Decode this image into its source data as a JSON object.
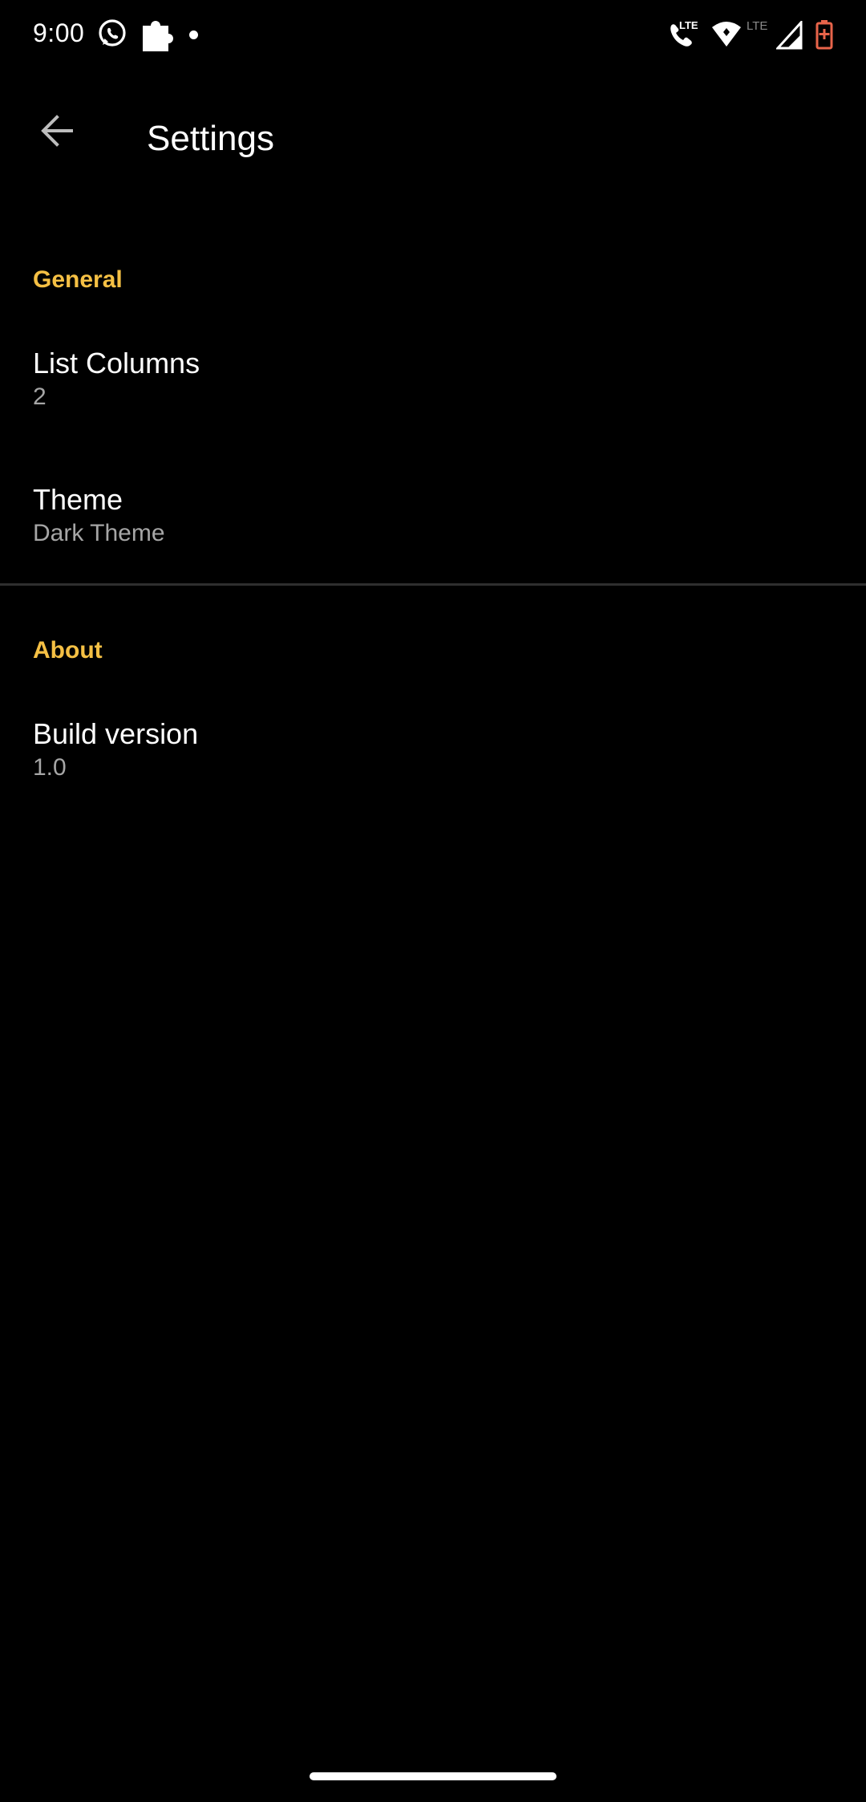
{
  "status_bar": {
    "time": "9:00",
    "lte_badge_1": "LTE",
    "lte_badge_2": "LTE",
    "icons": [
      "whatsapp-icon",
      "puzzle-icon",
      "notification-dot-icon",
      "volte-call-icon",
      "wifi-icon",
      "lte-icon",
      "signal-icon",
      "battery-charging-icon"
    ],
    "battery_color": "#e8644a"
  },
  "app_bar": {
    "title": "Settings",
    "back_icon": "arrow-back-icon"
  },
  "sections": [
    {
      "header": "General",
      "items": [
        {
          "title": "List Columns",
          "summary": "2"
        },
        {
          "title": "Theme",
          "summary": "Dark Theme"
        }
      ]
    },
    {
      "header": "About",
      "items": [
        {
          "title": "Build version",
          "summary": "1.0"
        }
      ]
    }
  ],
  "colors": {
    "background": "#000000",
    "accent": "#f5c044",
    "primary_text": "#ffffff",
    "secondary_text": "#a6a6a6",
    "divider": "#2e2e2e"
  }
}
